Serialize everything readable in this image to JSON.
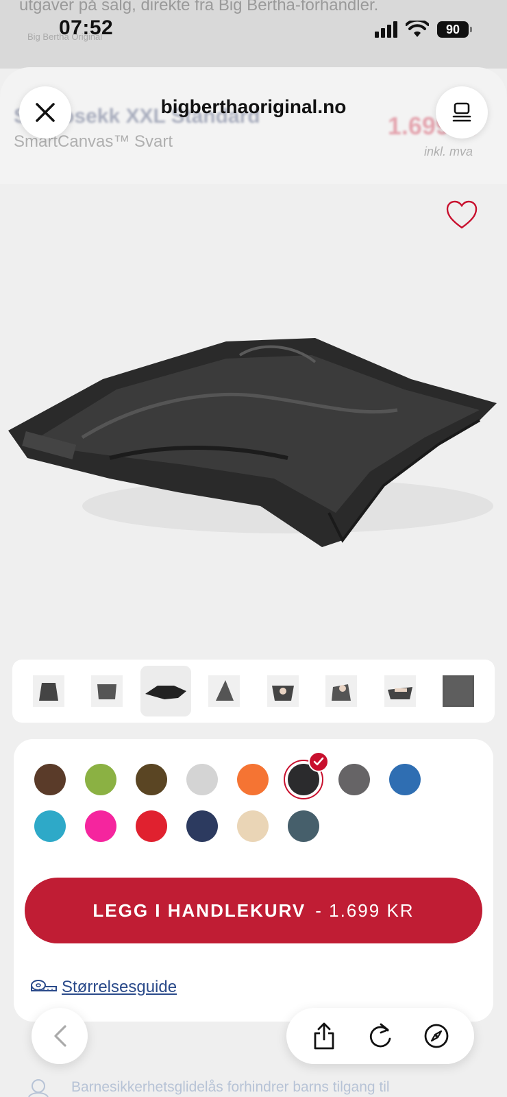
{
  "background_page": {
    "top_line": "utgaver på salg, direkte fra Big Bertha-forhandler.",
    "crumb": "Big Bertha Original"
  },
  "status_bar": {
    "time": "07:52",
    "battery": "90"
  },
  "browser": {
    "url": "bigberthaoriginal.no"
  },
  "product_header": {
    "title": "Saccosekk XXL Standard",
    "subtitle": "SmartCanvas™ Svart",
    "price": "1.699 kr",
    "vat": "inkl. mva"
  },
  "gallery": {
    "favorite_icon": "heart-outline-icon",
    "selected_index": 2,
    "thumbnails": [
      "bag-upright",
      "bag-square",
      "bag-flat",
      "bag-cone",
      "bag-with-person",
      "bag-person-lounging",
      "bag-person-lying",
      "fabric-closeup"
    ]
  },
  "colors": {
    "selected_index": 5,
    "swatches": [
      "#5a3b29",
      "#8bb143",
      "#5a4523",
      "#d4d4d4",
      "#f57433",
      "#2b2b2d",
      "#666466",
      "#2f6eb2",
      "#2ea9c8",
      "#f5259e",
      "#e0212f",
      "#2c3a5f",
      "#ead5b6",
      "#465f6b"
    ]
  },
  "cart": {
    "button_label": "LEGG I HANDLEKURV",
    "button_price": "- 1.699 KR",
    "accent": "#c01d34"
  },
  "size_guide": {
    "label": "Størrelsesguide"
  },
  "footer_note": {
    "text": "Barnesikkerhetsglidelås forhindrer barns tilgang til"
  }
}
